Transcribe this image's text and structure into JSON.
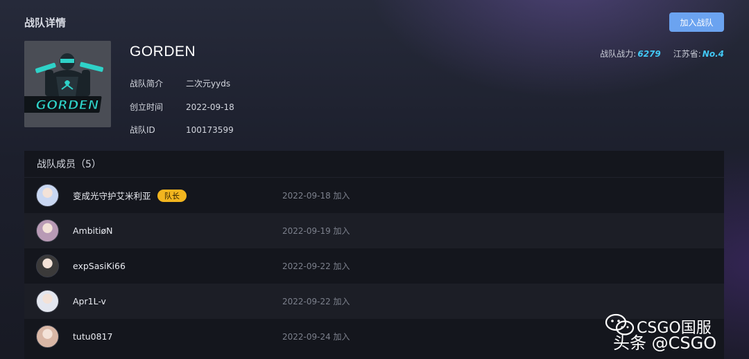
{
  "page": {
    "title": "战队详情"
  },
  "actions": {
    "join_label": "加入战队"
  },
  "stats": {
    "power_label": "战队战力:",
    "power_value": "6279",
    "rank_label": "江苏省:",
    "rank_value": "No.4"
  },
  "team": {
    "logo_text": "GORDEN",
    "name": "GORDEN",
    "intro_label": "战队简介",
    "intro_value": "二次元yyds",
    "founded_label": "创立时间",
    "founded_value": "2022-09-18",
    "id_label": "战队ID",
    "id_value": "100173599"
  },
  "members": {
    "header": "战队成员（5）",
    "list": [
      {
        "name": "变成光守护艾米利亚",
        "badge": "队长",
        "date": "2022-09-18 加入",
        "avatar_color": "#c9d7f2"
      },
      {
        "name": "AmbitiøN",
        "badge": "",
        "date": "2022-09-19 加入",
        "avatar_color": "#b89ab5"
      },
      {
        "name": "expSasiKi66",
        "badge": "",
        "date": "2022-09-22 加入",
        "avatar_color": "#3b3a3a"
      },
      {
        "name": "Apr1L-v",
        "badge": "",
        "date": "2022-09-22 加入",
        "avatar_color": "#e3e6ef"
      },
      {
        "name": "tutu0817",
        "badge": "",
        "date": "2022-09-24 加入",
        "avatar_color": "#d9b7a6"
      }
    ]
  },
  "watermark": {
    "line1": "CSGO国服",
    "line2": "头条 @CSGO"
  },
  "colors": {
    "accent": "#6ba3f0",
    "stat_value": "#42c8f5",
    "badge": "#f2b51f"
  }
}
